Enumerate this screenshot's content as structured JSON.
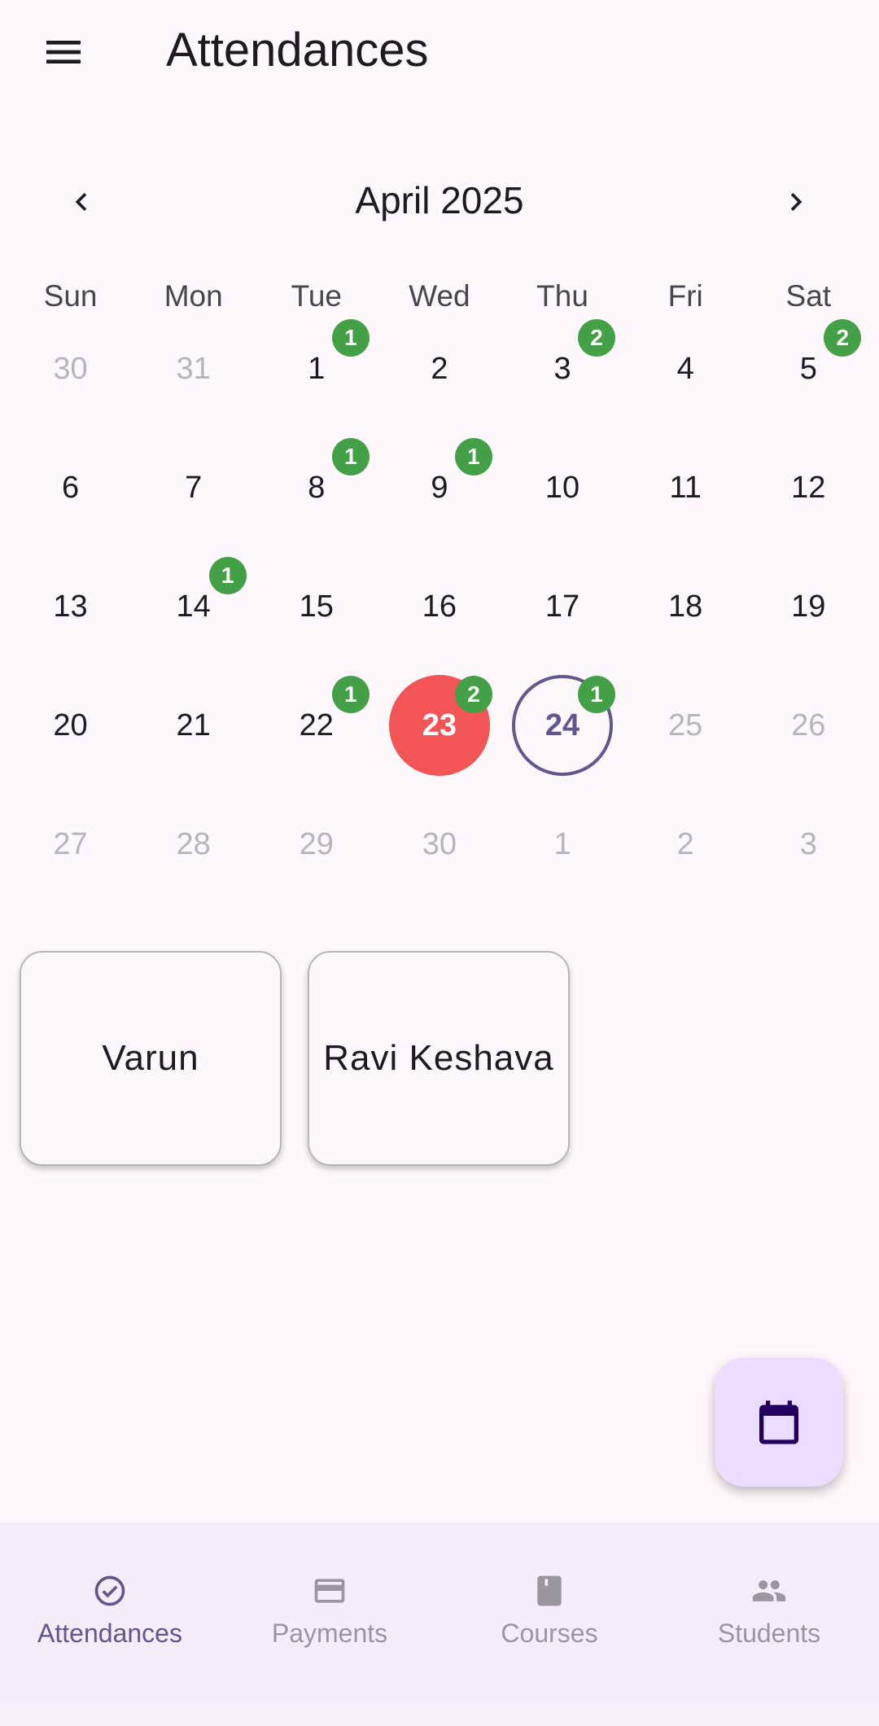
{
  "app_bar": {
    "title": "Attendances",
    "menu_icon": "menu-icon"
  },
  "calendar": {
    "month_title": "April 2025",
    "prev_icon": "chevron-left-icon",
    "next_icon": "chevron-right-icon",
    "weekdays": [
      "Sun",
      "Mon",
      "Tue",
      "Wed",
      "Thu",
      "Fri",
      "Sat"
    ],
    "weeks": [
      [
        {
          "day": "30",
          "outside": true
        },
        {
          "day": "31",
          "outside": true
        },
        {
          "day": "1",
          "badge": "1"
        },
        {
          "day": "2"
        },
        {
          "day": "3",
          "badge": "2"
        },
        {
          "day": "4"
        },
        {
          "day": "5",
          "badge": "2"
        }
      ],
      [
        {
          "day": "6"
        },
        {
          "day": "7"
        },
        {
          "day": "8",
          "badge": "1"
        },
        {
          "day": "9",
          "badge": "1"
        },
        {
          "day": "10"
        },
        {
          "day": "11"
        },
        {
          "day": "12"
        }
      ],
      [
        {
          "day": "13"
        },
        {
          "day": "14",
          "badge": "1"
        },
        {
          "day": "15"
        },
        {
          "day": "16"
        },
        {
          "day": "17"
        },
        {
          "day": "18"
        },
        {
          "day": "19"
        }
      ],
      [
        {
          "day": "20"
        },
        {
          "day": "21"
        },
        {
          "day": "22",
          "badge": "1"
        },
        {
          "day": "23",
          "badge": "2",
          "selected": true
        },
        {
          "day": "24",
          "badge": "1",
          "today": true
        },
        {
          "day": "25",
          "outside": true
        },
        {
          "day": "26",
          "outside": true
        }
      ],
      [
        {
          "day": "27",
          "outside": true
        },
        {
          "day": "28",
          "outside": true
        },
        {
          "day": "29",
          "outside": true
        },
        {
          "day": "30",
          "outside": true
        },
        {
          "day": "1",
          "outside": true
        },
        {
          "day": "2",
          "outside": true
        },
        {
          "day": "3",
          "outside": true
        }
      ]
    ]
  },
  "students": [
    {
      "name": "Varun"
    },
    {
      "name": "Ravi Keshava"
    }
  ],
  "fab": {
    "icon": "calendar-icon"
  },
  "bottom_nav": {
    "items": [
      {
        "label": "Attendances",
        "icon": "check-circle-icon",
        "active": true
      },
      {
        "label": "Payments",
        "icon": "credit-card-icon"
      },
      {
        "label": "Courses",
        "icon": "book-icon"
      },
      {
        "label": "Students",
        "icon": "people-icon"
      }
    ]
  },
  "colors": {
    "background": "#fef7fb",
    "selected_day": "#f35556",
    "today_ring": "#65558f",
    "badge": "#43a047",
    "fab": "#eaddff",
    "nav_bar": "#f3edf7",
    "nav_active": "#65558f",
    "nav_inactive": "#9a969d"
  }
}
